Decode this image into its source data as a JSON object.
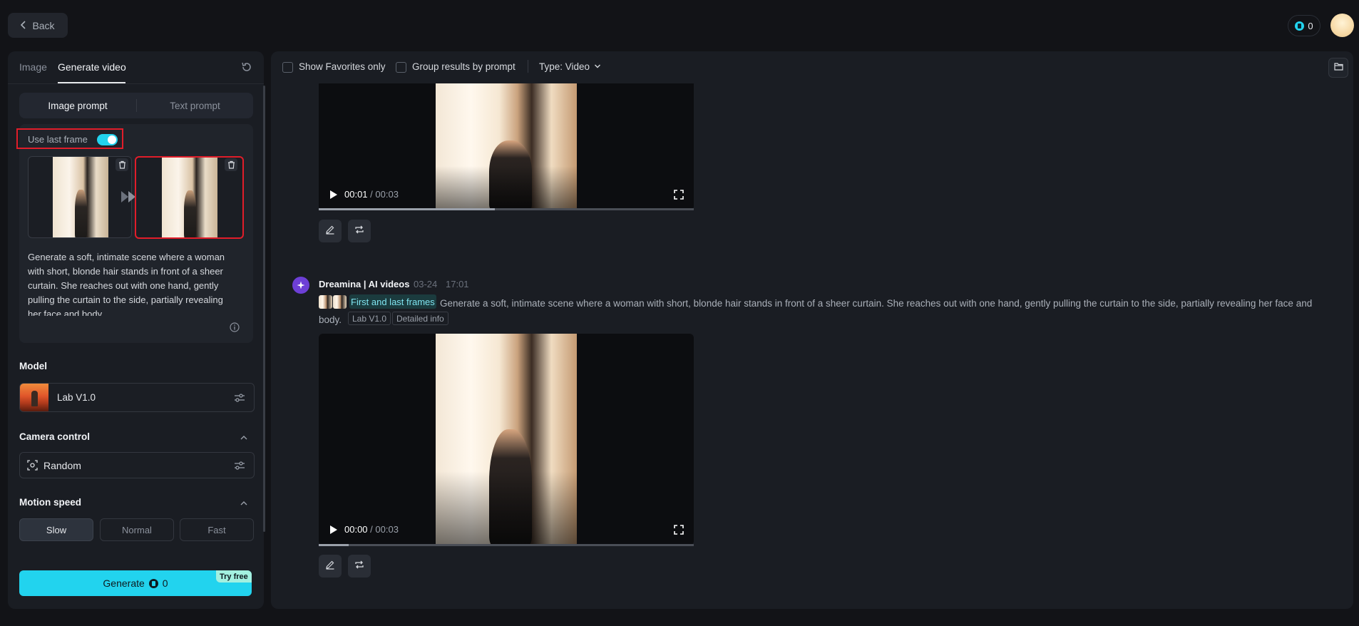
{
  "header": {
    "back_label": "Back",
    "credits": "0"
  },
  "left": {
    "tabs": [
      "Image",
      "Generate video"
    ],
    "prompt_mode": [
      "Image prompt",
      "Text prompt"
    ],
    "use_last_frame_label": "Use last frame",
    "use_last_frame_on": true,
    "prompt": "Generate a soft, intimate scene where a woman with short, blonde hair stands in front of a sheer curtain. She reaches out with one hand, gently pulling the curtain to the side, partially revealing her face and body.",
    "model_title": "Model",
    "model_name": "Lab V1.0",
    "camera_title": "Camera control",
    "camera_value": "Random",
    "motion_title": "Motion speed",
    "speeds": [
      "Slow",
      "Normal",
      "Fast"
    ],
    "speed_selected": "Slow",
    "generate_label": "Generate",
    "generate_cost": "0",
    "try_free": "Try free"
  },
  "right": {
    "show_favorites": "Show Favorites only",
    "group_results": "Group results by prompt",
    "type_filter": "Type: Video",
    "video1": {
      "current": "00:01",
      "duration": "/ 00:03",
      "progress": 0.47
    },
    "generation": {
      "title": "Dreamina | AI videos",
      "date": "03-24",
      "time": "17:01",
      "frames_tag": "First and last frames",
      "description": "Generate a soft, intimate scene where a woman with short, blonde hair stands in front of a sheer curtain. She reaches out with one hand, gently pulling the curtain to the side, partially revealing her face and body.",
      "chips": [
        "Lab V1.0",
        "Detailed info"
      ]
    },
    "video2": {
      "current": "00:00",
      "duration": "/ 00:03",
      "progress": 0.08
    }
  },
  "colors": {
    "accent": "#22d3ee",
    "highlight_box": "#e11d2a",
    "bot": "#6d3fd6"
  }
}
